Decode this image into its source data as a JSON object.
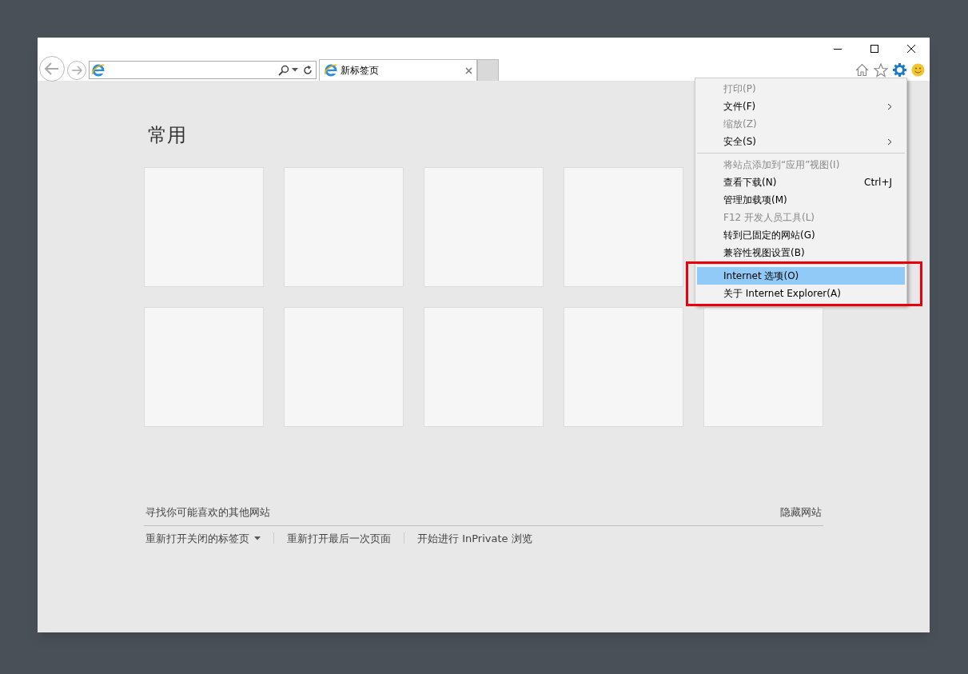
{
  "tabs": [
    {
      "label": "新标签页",
      "selected": true
    }
  ],
  "new_tab_page": {
    "heading": "常用",
    "discover_link": "寻找你可能喜欢的其他网站",
    "hide_link": "隐藏网站",
    "footer_links": [
      {
        "label": "重新打开关闭的标签页",
        "dropdown": true
      },
      {
        "label": "重新打开最后一次页面",
        "dropdown": false
      },
      {
        "label": "开始进行 InPrivate 浏览",
        "dropdown": false
      }
    ]
  },
  "tools_menu": {
    "items": [
      {
        "kind": "item",
        "label": "打印(P)",
        "disabled": true,
        "submenu": false,
        "selected": false
      },
      {
        "kind": "item",
        "label": "文件(F)",
        "disabled": false,
        "submenu": true,
        "selected": false
      },
      {
        "kind": "item",
        "label": "缩放(Z)",
        "disabled": true,
        "submenu": false,
        "selected": false
      },
      {
        "kind": "item",
        "label": "安全(S)",
        "disabled": false,
        "submenu": true,
        "selected": false
      },
      {
        "kind": "separator"
      },
      {
        "kind": "item",
        "label": "将站点添加到“应用”视图(I)",
        "disabled": true,
        "submenu": false,
        "selected": false
      },
      {
        "kind": "item",
        "label": "查看下载(N)",
        "shortcut": "Ctrl+J",
        "disabled": false,
        "submenu": false,
        "selected": false
      },
      {
        "kind": "item",
        "label": "管理加载项(M)",
        "disabled": false,
        "submenu": false,
        "selected": false
      },
      {
        "kind": "item",
        "label": "F12 开发人员工具(L)",
        "disabled": true,
        "submenu": false,
        "selected": false
      },
      {
        "kind": "item",
        "label": "转到已固定的网站(G)",
        "disabled": false,
        "submenu": false,
        "selected": false
      },
      {
        "kind": "item",
        "label": "兼容性视图设置(B)",
        "disabled": false,
        "submenu": false,
        "selected": false
      },
      {
        "kind": "separator"
      },
      {
        "kind": "item",
        "label": "Internet 选项(O)",
        "disabled": false,
        "submenu": false,
        "selected": true
      },
      {
        "kind": "item",
        "label": "关于 Internet Explorer(A)",
        "disabled": false,
        "submenu": false,
        "selected": false
      }
    ]
  }
}
